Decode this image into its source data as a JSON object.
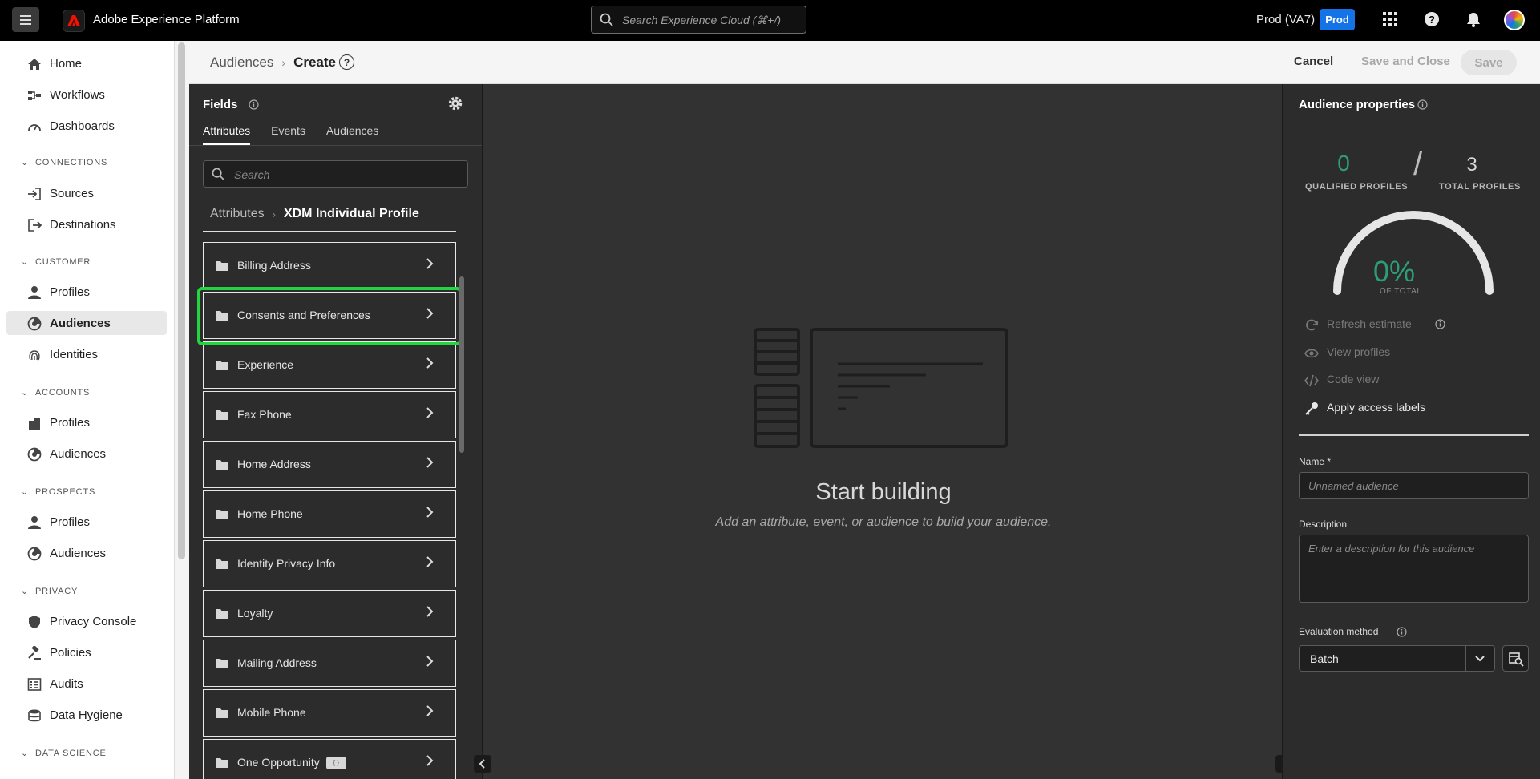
{
  "topbar": {
    "app_title": "Adobe Experience Platform",
    "search_placeholder": "Search Experience Cloud (⌘+/)",
    "org_name": "Prod (VA7)",
    "sandbox_badge": "Prod",
    "icons": [
      "menu-icon",
      "adobe-logo-icon",
      "search-icon",
      "apps-grid-icon",
      "help-icon",
      "bell-icon",
      "avatar"
    ]
  },
  "leftnav": {
    "items": {
      "home": "Home",
      "workflows": "Workflows",
      "dashboards": "Dashboards",
      "sources": "Sources",
      "destinations": "Destinations",
      "customer_profiles": "Profiles",
      "customer_audiences": "Audiences",
      "identities": "Identities",
      "accounts_profiles": "Profiles",
      "accounts_audiences": "Audiences",
      "prospects_profiles": "Profiles",
      "prospects_audiences": "Audiences",
      "privacy_console": "Privacy Console",
      "policies": "Policies",
      "audits": "Audits",
      "data_hygiene": "Data Hygiene"
    },
    "sections": {
      "connections": "CONNECTIONS",
      "customer": "CUSTOMER",
      "accounts": "ACCOUNTS",
      "prospects": "PROSPECTS",
      "privacy": "PRIVACY",
      "data_science": "DATA SCIENCE"
    },
    "active_item": "customer_audiences"
  },
  "header": {
    "breadcrumb_parent": "Audiences",
    "breadcrumb_current": "Create",
    "help": "?",
    "cancel": "Cancel",
    "save_and_close": "Save and Close",
    "save": "Save"
  },
  "fields_panel": {
    "title": "Fields",
    "tabs": [
      "Attributes",
      "Events",
      "Audiences"
    ],
    "active_tab": "Attributes",
    "search_placeholder": "Search",
    "breadcrumb_parent": "Attributes",
    "breadcrumb_current": "XDM Individual Profile",
    "items": [
      "Billing Address",
      "Consents and Preferences",
      "Experience",
      "Fax Phone",
      "Home Address",
      "Home Phone",
      "Identity Privacy Info",
      "Loyalty",
      "Mailing Address",
      "Mobile Phone",
      "One Opportunity"
    ],
    "highlighted_item": "Consents and Preferences"
  },
  "canvas": {
    "title": "Start building",
    "subtitle": "Add an attribute, event, or audience to build your audience."
  },
  "properties": {
    "title": "Audience properties",
    "qualified_value": "0",
    "qualified_label": "QUALIFIED PROFILES",
    "separator": "/",
    "total_value": "3",
    "total_label": "TOTAL PROFILES",
    "gauge_percent": "0%",
    "gauge_fraction": 0,
    "gauge_label": "OF TOTAL",
    "actions": {
      "refresh": "Refresh estimate",
      "view_profiles": "View profiles",
      "code_view": "Code view",
      "access_labels": "Apply access labels"
    },
    "name_label": "Name *",
    "name_placeholder": "Unnamed audience",
    "description_label": "Description",
    "description_placeholder": "Enter a description for this audience",
    "evaluation_label": "Evaluation method",
    "evaluation_value": "Batch"
  },
  "colors": {
    "accent_green": "#2d9d78",
    "highlight": "#22d640",
    "badge_blue": "#1473e6"
  }
}
